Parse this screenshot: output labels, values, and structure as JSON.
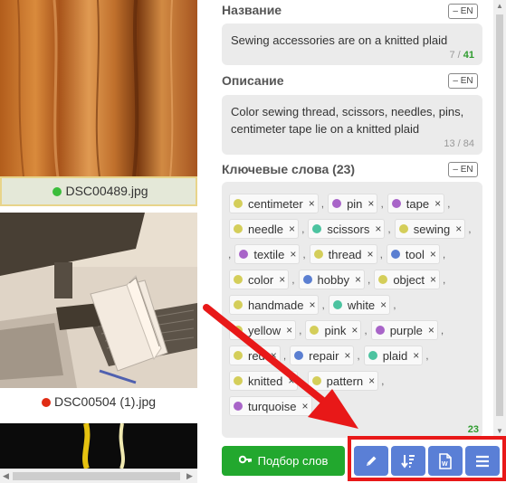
{
  "left_panel": {
    "thumbs": [
      {
        "filename": "DSC00489.jpg",
        "status_color": "#3bbd3b"
      },
      {
        "filename": "DSC00504 (1).jpg",
        "status_color": "#e02c14"
      }
    ]
  },
  "right_panel": {
    "title": {
      "label": "Название",
      "lang": "EN",
      "value": "Sewing accessories are on a knitted plaid",
      "count": "7 / ",
      "count_highlight": "41"
    },
    "description": {
      "label": "Описание",
      "lang": "EN",
      "value": "Color sewing thread, scissors, needles, pins, centimeter tape lie on a knitted plaid",
      "count": "13 / 84"
    },
    "keywords": {
      "label": "Ключевые слова (23)",
      "lang": "EN",
      "count": "23",
      "rows": [
        [
          {
            "text": "centimeter",
            "color": "#d4ce5a"
          },
          {
            "text": "pin",
            "color": "#a864c8"
          },
          {
            "text": "tape",
            "color": "#a864c8"
          }
        ],
        [
          {
            "text": "needle",
            "color": "#d4ce5a"
          },
          {
            "text": "scissors",
            "color": "#4cc3a0"
          },
          {
            "text": "sewing",
            "color": "#d4ce5a"
          }
        ],
        [
          {
            "text": "textile",
            "color": "#a864c8"
          },
          {
            "text": "thread",
            "color": "#d4ce5a"
          },
          {
            "text": "tool",
            "color": "#5b7fd1"
          }
        ],
        [
          {
            "text": "color",
            "color": "#d4ce5a"
          },
          {
            "text": "hobby",
            "color": "#5b7fd1"
          },
          {
            "text": "object",
            "color": "#d4ce5a"
          }
        ],
        [
          {
            "text": "handmade",
            "color": "#d4ce5a"
          },
          {
            "text": "white",
            "color": "#4cc3a0"
          }
        ],
        [
          {
            "text": "yellow",
            "color": "#d4ce5a"
          },
          {
            "text": "pink",
            "color": "#d4ce5a"
          },
          {
            "text": "purple",
            "color": "#a864c8"
          }
        ],
        [
          {
            "text": "red",
            "color": "#d4ce5a"
          },
          {
            "text": "repair",
            "color": "#5b7fd1"
          },
          {
            "text": "plaid",
            "color": "#4cc3a0"
          }
        ],
        [
          {
            "text": "knitted",
            "color": "#d4ce5a"
          },
          {
            "text": "pattern",
            "color": "#d4ce5a"
          }
        ],
        [
          {
            "text": "turquoise",
            "color": "#a864c8"
          }
        ]
      ]
    }
  },
  "toolbar": {
    "select_words_label": "Подбор слов",
    "buttons": [
      "pencil-icon",
      "sort-icon",
      "word-doc-icon",
      "menu-icon"
    ]
  },
  "colors": {
    "accent_green": "#22a82e",
    "accent_blue": "#5a7fd6",
    "highlight_red": "#e81818"
  }
}
